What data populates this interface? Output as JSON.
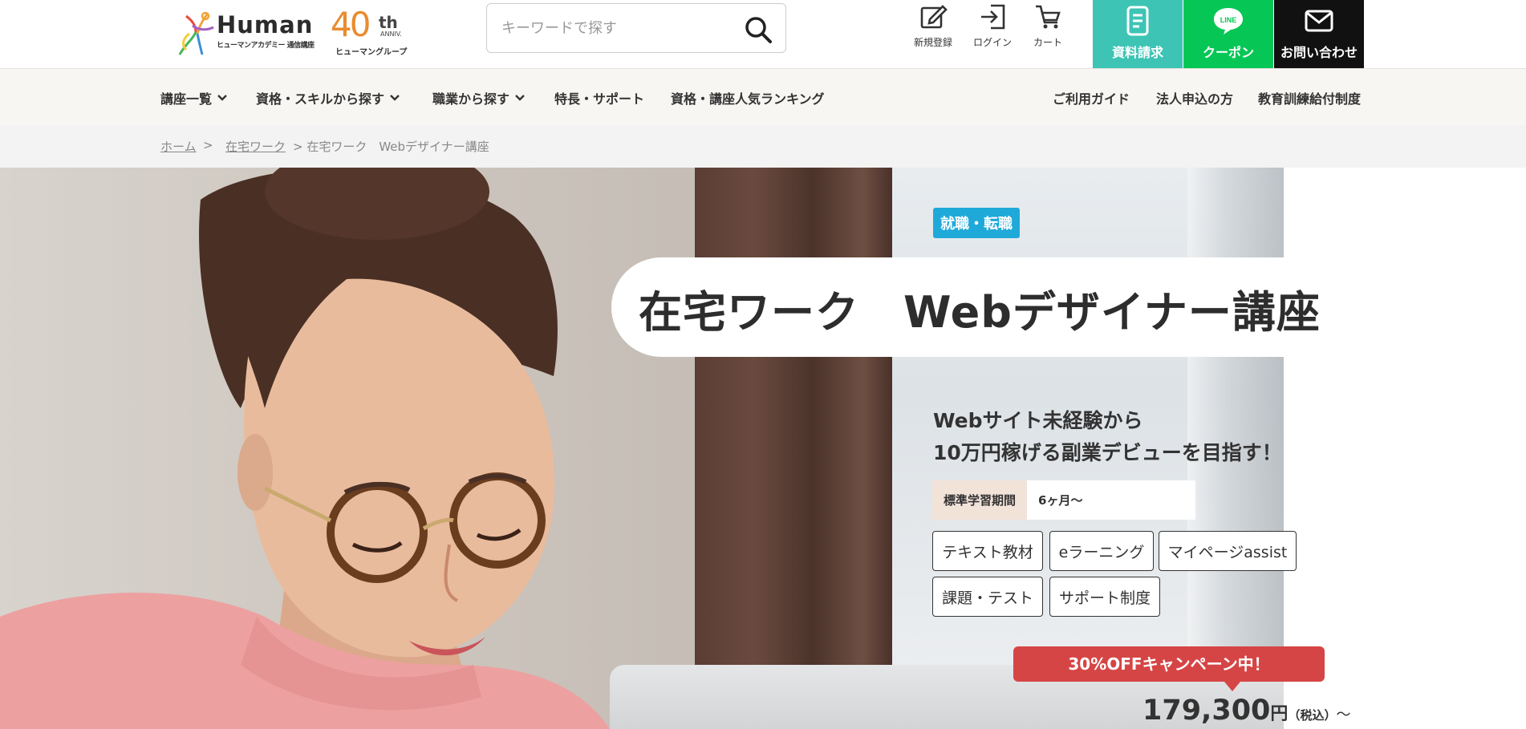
{
  "header": {
    "logo": {
      "brand": "Human",
      "sub": "ヒューマンアカデミー 通信講座",
      "anniv_num": "40",
      "anniv_th": "th",
      "anniv_sm": "ANNIV.",
      "group": "ヒューマングループ"
    },
    "search": {
      "placeholder": "キーワードで探す"
    },
    "utils": {
      "register": "新規登録",
      "login": "ログイン",
      "cart": "カート"
    },
    "cta": {
      "brochure": "資料請求",
      "coupon": "クーポン",
      "line_badge": "LINE",
      "contact": "お問い合わせ"
    }
  },
  "nav": {
    "courses": "講座一覧",
    "by_skill": "資格・スキルから探す",
    "by_job": "職業から探す",
    "features": "特長・サポート",
    "ranking": "資格・講座人気ランキング",
    "guide": "ご利用ガイド",
    "corporate": "法人申込の方",
    "training_benefit": "教育訓練給付制度"
  },
  "breadcrumb": {
    "home": "ホーム",
    "sep1": ">",
    "category": "在宅ワーク",
    "current": "> 在宅ワーク　Webデザイナー講座"
  },
  "hero": {
    "badge": "就職・転職",
    "title": "在宅ワーク　Webデザイナー講座",
    "catch_line1": "Webサイト未経験から",
    "catch_line2": "10万円稼げる副業デビューを目指す！",
    "period_label": "標準学習期間",
    "period_value": "6ヶ月〜",
    "features": [
      "テキスト教材",
      "eラーニング",
      "マイページassist",
      "課題・テスト",
      "サポート制度"
    ],
    "campaign": "30%OFFキャンペーン中！",
    "price": "179,300",
    "price_unit": "円",
    "price_tax": "（税込）",
    "price_suffix": "〜"
  },
  "colors": {
    "brochure_bg": "#3dc4b5",
    "coupon_bg": "#06c755",
    "contact_bg": "#111111",
    "badge_bg": "#1fa9d9",
    "campaign_bg": "#d64545",
    "nav_bg": "#f8f6f3"
  },
  "icons": {
    "search": "search-icon",
    "register": "pencil-square-icon",
    "login": "login-arrow-icon",
    "cart": "cart-icon",
    "brochure": "document-icon",
    "coupon": "line-chat-icon",
    "contact": "mail-icon",
    "chevron": "chevron-down-icon"
  }
}
